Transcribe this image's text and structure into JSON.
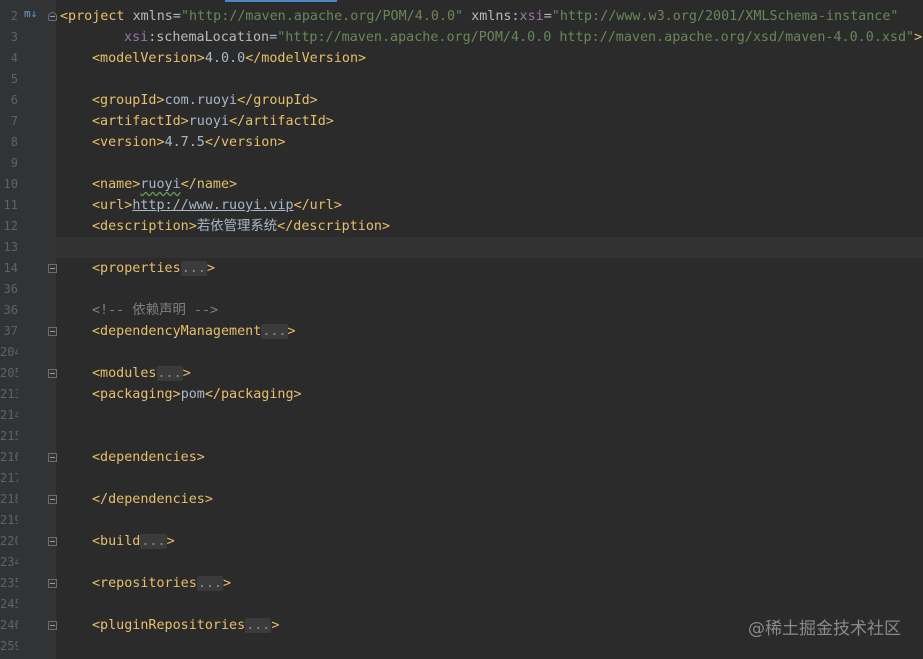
{
  "gutter": {
    "line_numbers": [
      "2",
      "3",
      "4",
      "5",
      "6",
      "7",
      "8",
      "9",
      "10",
      "11",
      "12",
      "13",
      "14",
      "36",
      "36",
      "37",
      "204",
      "205",
      "213",
      "214",
      "215",
      "216",
      "217",
      "218",
      "219",
      "220",
      "234",
      "235",
      "245",
      "246",
      "259"
    ]
  },
  "code": {
    "l2": {
      "open": "<project",
      "a1": "xmlns",
      "v1": "\"http://maven.apache.org/POM/4.0.0\"",
      "a2_ns": "xmlns",
      "a2_colon": ":",
      "a2_name": "xsi",
      "v2": "\"http://www.w3.org/2001/XMLSchema-instance\""
    },
    "l3": {
      "ns": "xsi",
      "colon": ":",
      "attr": "schemaLocation",
      "val": "\"http://maven.apache.org/POM/4.0.0 http://maven.apache.org/xsd/maven-4.0.0.xsd\"",
      "close": ">"
    },
    "l4": {
      "open": "<modelVersion>",
      "text": "4.0.0",
      "close": "</modelVersion>"
    },
    "l6": {
      "open": "<groupId>",
      "text": "com.ruoyi",
      "close": "</groupId>"
    },
    "l7": {
      "open": "<artifactId>",
      "text": "ruoyi",
      "close": "</artifactId>"
    },
    "l8": {
      "open": "<version>",
      "text": "4.7.5",
      "close": "</version>"
    },
    "l10": {
      "open": "<name>",
      "text": "ruoyi",
      "close": "</name>"
    },
    "l11": {
      "open": "<url>",
      "text": "http://www.ruoyi.vip",
      "close": "</url>"
    },
    "l12": {
      "open": "<description>",
      "text": "若依管理系统",
      "close": "</description>"
    },
    "l14": {
      "open": "<properties",
      "fold": "...",
      "close": ">"
    },
    "l36": {
      "comment": "<!-- 依赖声明 -->"
    },
    "l37": {
      "open": "<dependencyManagement",
      "fold": "...",
      "close": ">"
    },
    "l205": {
      "open": "<modules",
      "fold": "...",
      "close": ">"
    },
    "l213": {
      "open": "<packaging>",
      "text": "pom",
      "close": "</packaging>"
    },
    "l216": {
      "open": "<dependencies>"
    },
    "l218": {
      "close": "</dependencies>"
    },
    "l220": {
      "open": "<build",
      "fold": "...",
      "close": ">"
    },
    "l235": {
      "open": "<repositories",
      "fold": "...",
      "close": ">"
    },
    "l246": {
      "open": "<pluginRepositories",
      "fold": "...",
      "close": ">"
    }
  },
  "watermark": "@稀土掘金技术社区",
  "icons": {
    "vcs": "m↓"
  },
  "colors": {
    "background": "#2b2b2b",
    "gutter": "#313335",
    "tag": "#e8bf6a",
    "string": "#6a8759",
    "comment": "#808080"
  }
}
